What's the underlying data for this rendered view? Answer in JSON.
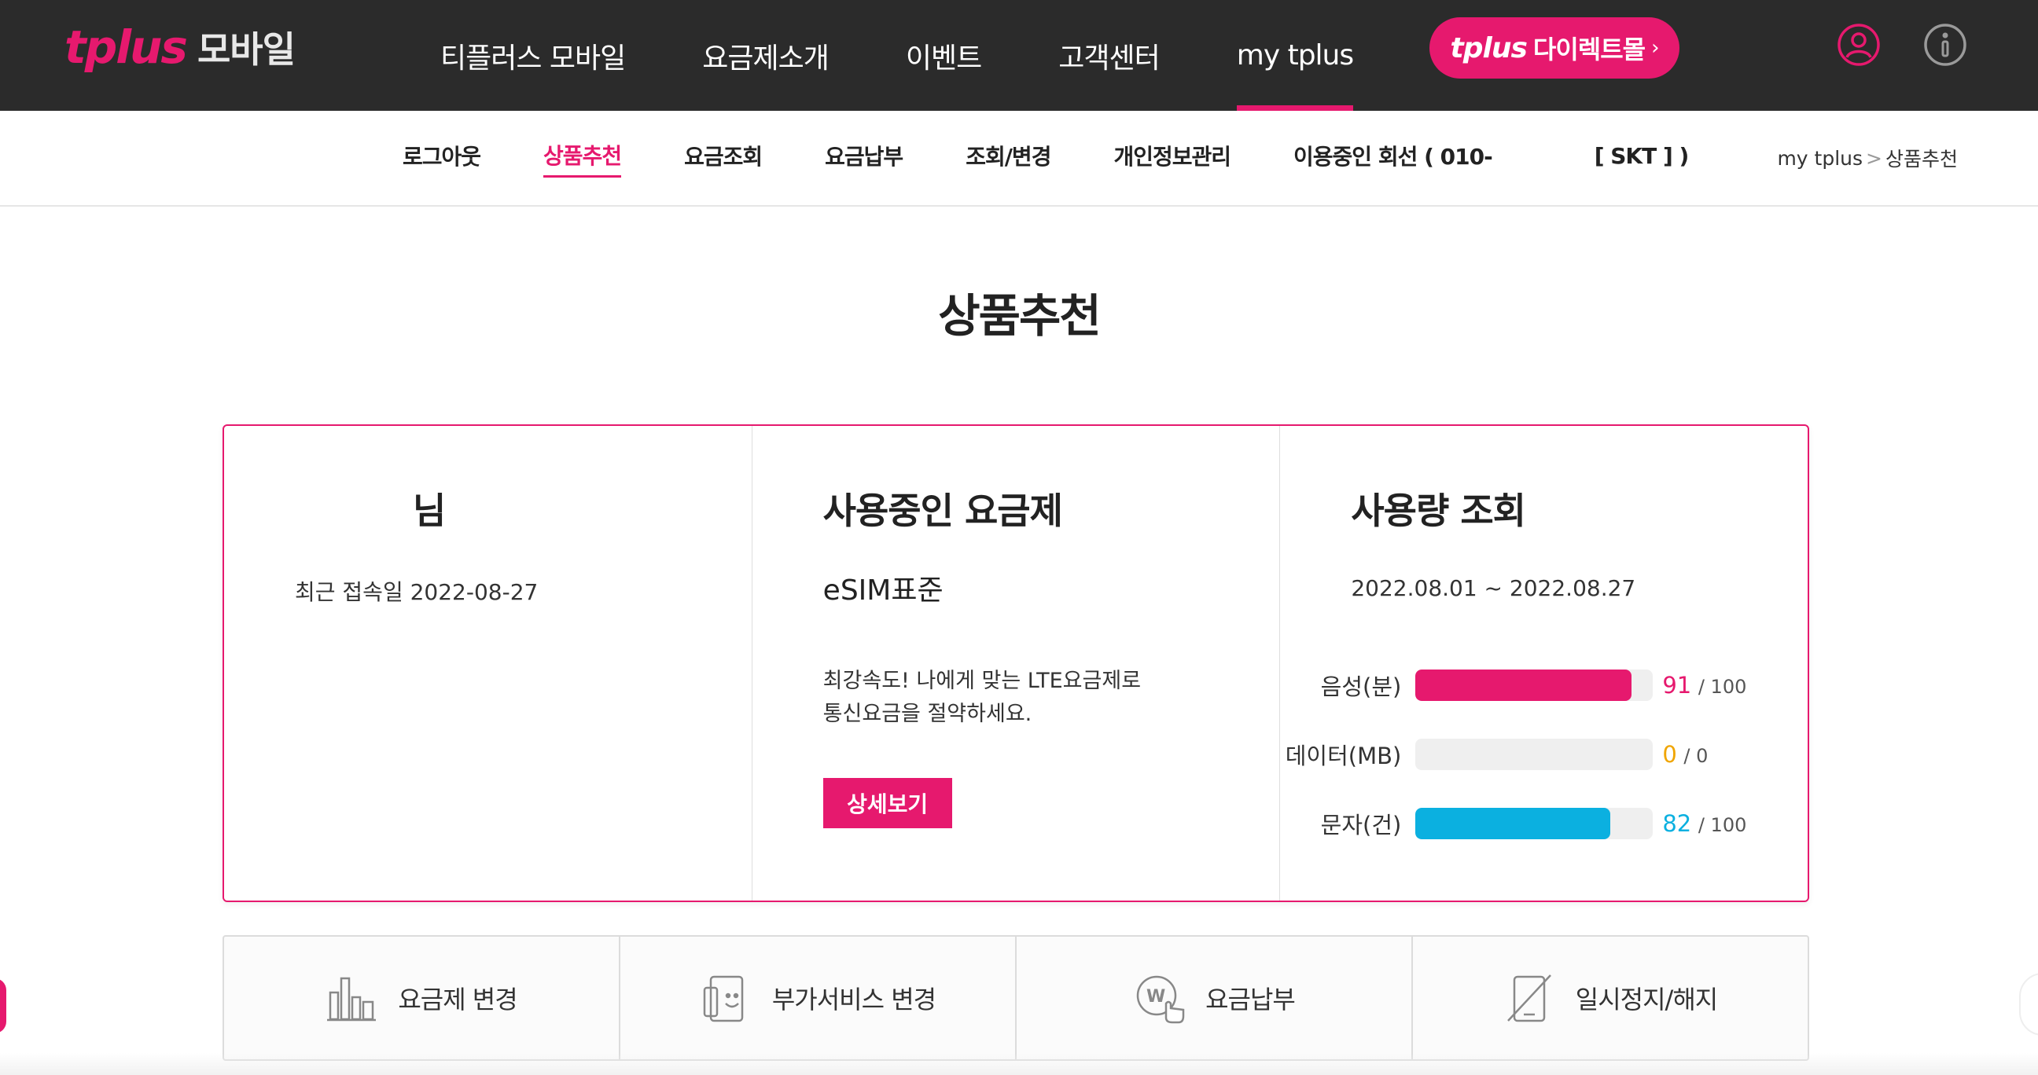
{
  "header": {
    "logo_brand": "tplus",
    "logo_sub": "모바일",
    "nav": [
      {
        "label": "티플러스 모바일",
        "active": false
      },
      {
        "label": "요금제소개",
        "active": false
      },
      {
        "label": "이벤트",
        "active": false
      },
      {
        "label": "고객센터",
        "active": false
      },
      {
        "label": "my tplus",
        "active": true
      }
    ],
    "direct_mall": {
      "brand": "tplus",
      "label": "다이렉트몰",
      "chevron": "›"
    },
    "icons": [
      "user-icon",
      "info-icon"
    ]
  },
  "subnav": {
    "items": [
      {
        "label": "로그아웃",
        "active": false
      },
      {
        "label": "상품추천",
        "active": true
      },
      {
        "label": "요금조회",
        "active": false
      },
      {
        "label": "요금납부",
        "active": false
      },
      {
        "label": "조회/변경",
        "active": false
      },
      {
        "label": "개인정보관리",
        "active": false
      }
    ],
    "line_prefix": "이용중인 회선 ( 010-",
    "line_suffix": "[ SKT ] )",
    "breadcrumb": [
      "my tplus",
      "상품추천"
    ],
    "breadcrumb_sep": ">"
  },
  "page": {
    "title": "상품추천"
  },
  "user_card": {
    "name": "님",
    "recent_login": "최근 접속일 2022-08-27"
  },
  "plan_card": {
    "heading": "사용중인 요금제",
    "plan_name": "eSIM표준",
    "desc_line1": "최강속도! 나에게 맞는 LTE요금제로",
    "desc_line2": "통신요금을 절약하세요.",
    "detail_button": "상세보기"
  },
  "usage_card": {
    "heading": "사용량 조회",
    "period": "2022.08.01 ~ 2022.08.27",
    "rows": [
      {
        "label": "음성(분)",
        "value": "91",
        "total": "/ 100",
        "fraction": 0.91,
        "color": "#e6196e"
      },
      {
        "label": "데이터(MB)",
        "value": "0",
        "total": "/ 0",
        "fraction": 0,
        "color": "#f0a500"
      },
      {
        "label": "문자(건)",
        "value": "82",
        "total": "/ 100",
        "fraction": 0.82,
        "color": "#0bb0e0"
      }
    ]
  },
  "quick_menu": [
    {
      "label": "요금제 변경",
      "icon": "plan-change-icon"
    },
    {
      "label": "부가서비스 변경",
      "icon": "addon-service-icon"
    },
    {
      "label": "요금납부",
      "icon": "payment-icon"
    },
    {
      "label": "일시정지/해지",
      "icon": "suspend-icon"
    }
  ],
  "colors": {
    "brand": "#e6196e",
    "topbar": "#2b2b2b"
  }
}
